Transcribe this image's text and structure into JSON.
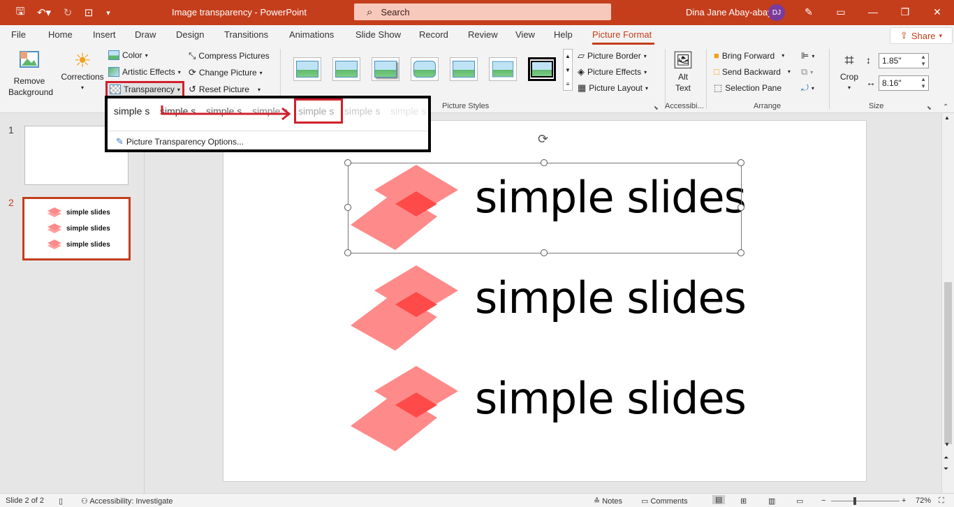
{
  "app": {
    "document_title": "Image transparency",
    "app_name": "PowerPoint",
    "title_separator": "-",
    "search_placeholder": "Search",
    "user_name": "Dina Jane Abay-abay",
    "user_initials": "DJ"
  },
  "tabs": [
    "File",
    "Home",
    "Insert",
    "Draw",
    "Design",
    "Transitions",
    "Animations",
    "Slide Show",
    "Record",
    "Review",
    "View",
    "Help",
    "Picture Format"
  ],
  "active_tab": "Picture Format",
  "share_label": "Share",
  "ribbon": {
    "remove_background": "Remove Background",
    "corrections": "Corrections",
    "color": "Color",
    "artistic_effects": "Artistic Effects",
    "transparency": "Transparency",
    "compress_pictures": "Compress Pictures",
    "change_picture": "Change Picture",
    "reset_picture": "Reset Picture",
    "picture_styles_group": "Picture Styles",
    "picture_border": "Picture Border",
    "picture_effects": "Picture Effects",
    "picture_layout": "Picture Layout",
    "alt_text_line1": "Alt",
    "alt_text_line2": "Text",
    "accessibility_group": "Accessibi...",
    "bring_forward": "Bring Forward",
    "send_backward": "Send Backward",
    "selection_pane": "Selection Pane",
    "arrange_group": "Arrange",
    "crop": "Crop",
    "height_value": "1.85\"",
    "width_value": "8.16\"",
    "size_group": "Size"
  },
  "dropdown": {
    "preview_text": [
      "simple s",
      "simple s",
      "simple s",
      "simple s",
      "simple s",
      "simple s",
      "simple s"
    ],
    "preview_opacity": [
      1.0,
      0.85,
      0.7,
      0.55,
      0.4,
      0.25,
      0.12
    ],
    "options_label": "Picture Transparency Options..."
  },
  "slides_panel": {
    "numbers": [
      "1",
      "2"
    ],
    "thumb_lines": [
      "simple slides",
      "simple slides",
      "simple slides"
    ]
  },
  "slide": {
    "logo_text": [
      "simple slides",
      "simple slides",
      "simple slides"
    ]
  },
  "status": {
    "slide_info": "Slide 2 of 2",
    "accessibility": "Accessibility: Investigate",
    "notes": "Notes",
    "comments": "Comments",
    "zoom": "72%"
  },
  "colors": {
    "accent": "#c43e1c",
    "highlight_red": "#d0202c",
    "logo_pink": "#ff8a8a",
    "logo_overlap": "#ff4a4a"
  }
}
